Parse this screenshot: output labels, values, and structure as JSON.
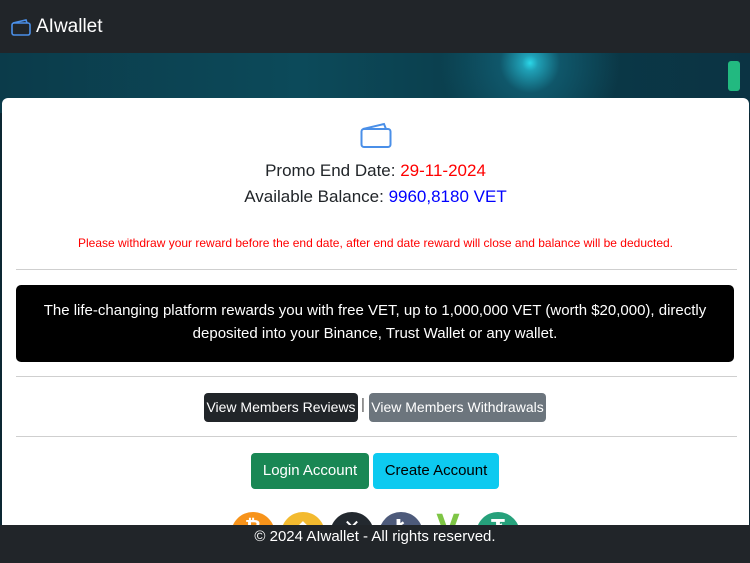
{
  "navbar": {
    "brand": "AIwallet",
    "icon": "wallet-icon"
  },
  "card": {
    "icon": "wallet-icon",
    "promo_label": "Promo End Date:",
    "promo_date": "29-11-2024",
    "balance_label": "Available Balance:",
    "balance_value": "9960,8180 VET",
    "warning": "Please withdraw your reward before the end date, after end date reward will close and balance will be deducted.",
    "info": "The life-changing platform rewards you with free VET, up to 1,000,000 VET (worth $20,000), directly deposited into your Binance, Trust Wallet or any wallet.",
    "reviews_button": "View Members Reviews",
    "separator": "|",
    "withdrawals_button": "View Members Withdrawals",
    "login_button": "Login Account",
    "create_button": "Create Account",
    "coins": [
      {
        "icon": "bitcoin-icon",
        "glyph": "₿",
        "color": "#f7931a"
      },
      {
        "icon": "binance-icon",
        "glyph": "◆",
        "color": "#f3ba2f"
      },
      {
        "icon": "xrp-icon",
        "glyph": "✕",
        "color": "#23292f"
      },
      {
        "icon": "litecoin-icon",
        "glyph": "Ł",
        "color": "#4d5a7a"
      },
      {
        "icon": "vechain-icon",
        "glyph": "V",
        "color": "#7ec545"
      },
      {
        "icon": "tether-icon",
        "glyph": "₮",
        "color": "#26a17b"
      }
    ]
  },
  "footer": {
    "text": "© 2024 AIwallet - All rights reserved."
  },
  "colors": {
    "navbar": "#212529",
    "red": "#ff0000",
    "blue": "#0000ff",
    "green": "#198754",
    "cyan": "#0dcaf0",
    "gray": "#6c757d"
  }
}
